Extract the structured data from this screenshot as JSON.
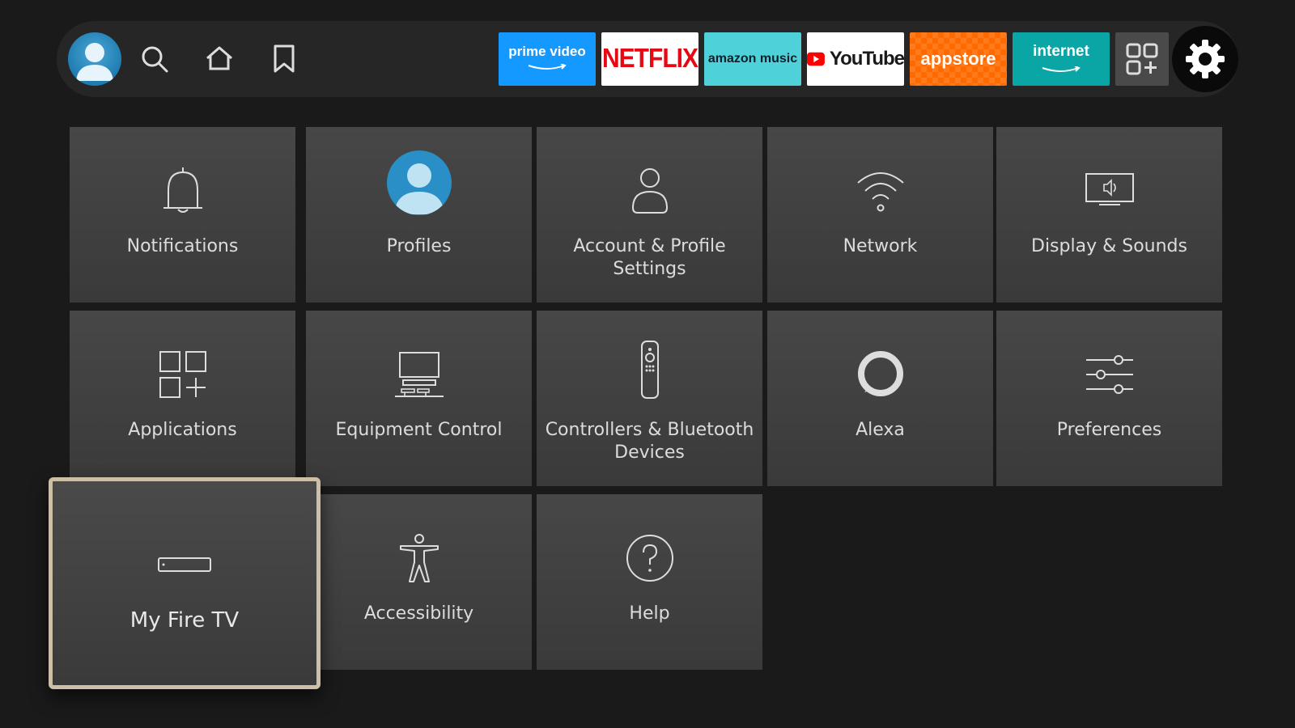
{
  "topbar": {
    "apps": {
      "prime_video": "prime video",
      "netflix": "NETFLIX",
      "amazon_music": "amazon music",
      "youtube": "YouTube",
      "appstore": "appstore",
      "internet": "internet"
    }
  },
  "grid": {
    "notifications": "Notifications",
    "profiles": "Profiles",
    "account": "Account & Profile Settings",
    "network": "Network",
    "display": "Display & Sounds",
    "applications": "Applications",
    "equipment": "Equipment Control",
    "controllers": "Controllers & Bluetooth Devices",
    "alexa": "Alexa",
    "preferences": "Preferences",
    "myfiretv": "My Fire TV",
    "accessibility": "Accessibility",
    "help": "Help"
  },
  "colors": {
    "background": "#1a1a1a",
    "tile": "#404040",
    "focus_border": "#cdbfa6",
    "prime_blue": "#1399ff",
    "netflix_red": "#e50914"
  }
}
